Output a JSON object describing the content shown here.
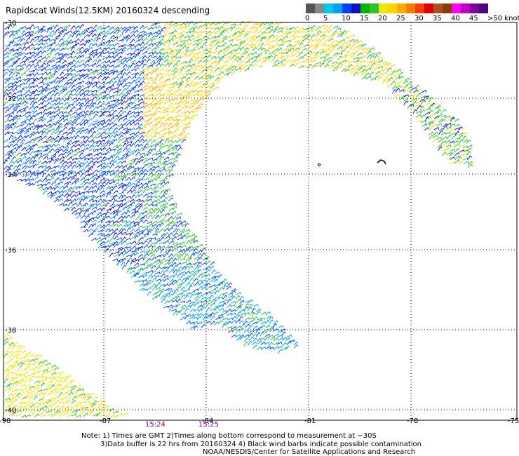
{
  "title": "Rapidscat Winds(12.5KM) 20160324 descending",
  "legend": {
    "ticks": [
      "0",
      "5",
      "10",
      "15",
      "20",
      "25",
      "30",
      "35",
      "40",
      "45",
      ">50 knots"
    ],
    "colors": [
      "#555555",
      "#888888",
      "#00c8f0",
      "#00a0f0",
      "#0040ff",
      "#1010c0",
      "#00b400",
      "#30c030",
      "#e8e800",
      "#ffd200",
      "#ffaa00",
      "#ff7800",
      "#ff3c00",
      "#e00000",
      "#b05020",
      "#8a4000",
      "#ff00ff",
      "#c000c0",
      "#8000a0",
      "#500080"
    ]
  },
  "axes": {
    "lat_labels": [
      "-30",
      "-32",
      "-34",
      "-36",
      "-38",
      "-40"
    ],
    "lon_labels": [
      "-90",
      "-87",
      "-84",
      "-81",
      "-78",
      "-75"
    ]
  },
  "times": [
    "15:24",
    "15:25"
  ],
  "notes": {
    "line1": "Note: 1) Times are GMT 2)Times along bottom correspond to measurement at −30S",
    "line2": "3)Data buffer is 22 hrs from 20160324 4) Black wind barbs indicate possible contamination",
    "line3": "NOAA/NESDIS/Center for Satellite Applications and Research"
  }
}
